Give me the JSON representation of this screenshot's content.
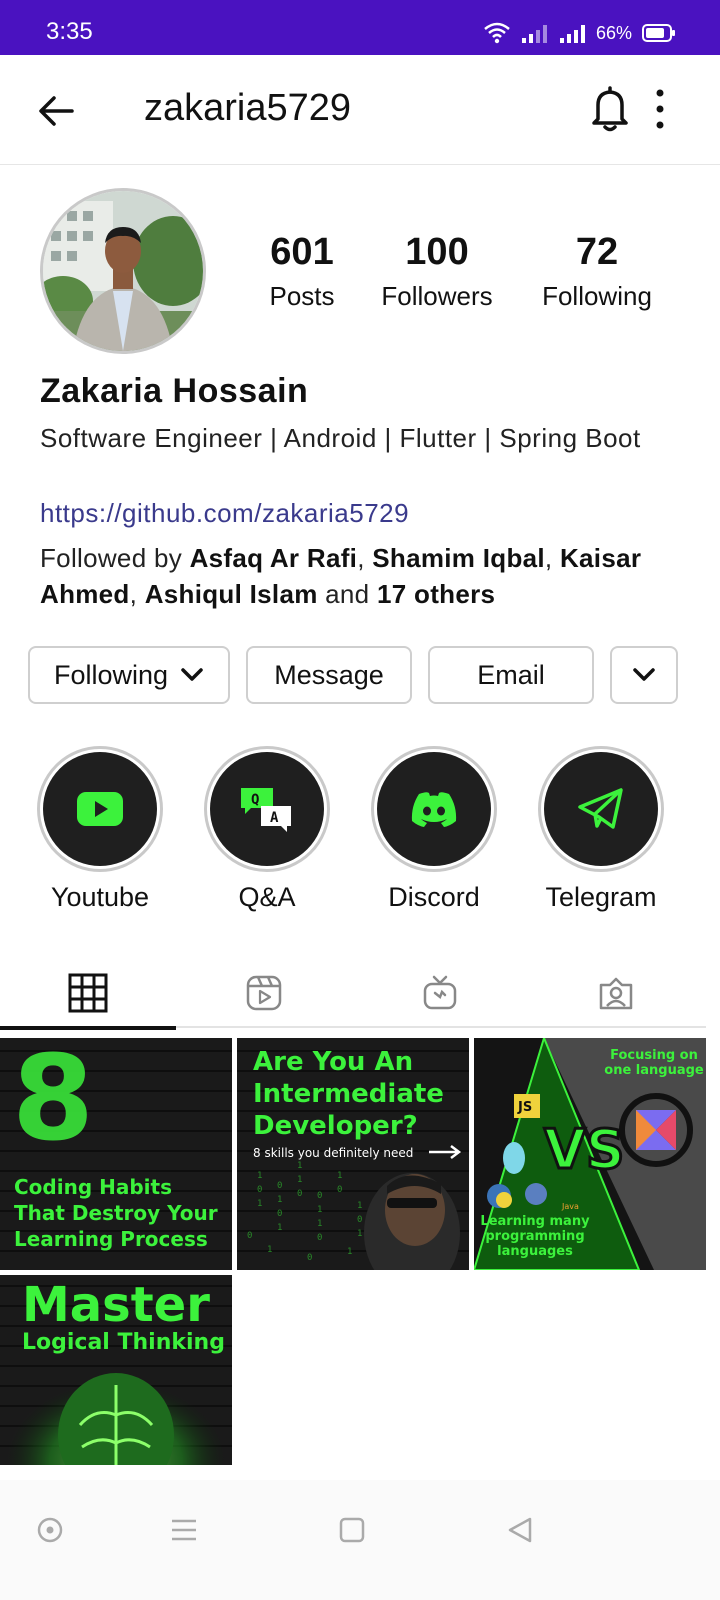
{
  "status": {
    "time": "3:35",
    "battery": "66%"
  },
  "header": {
    "username": "zakaria5729"
  },
  "stats": {
    "posts": {
      "value": "601",
      "label": "Posts"
    },
    "followers": {
      "value": "100",
      "label": "Followers"
    },
    "following": {
      "value": "72",
      "label": "Following"
    }
  },
  "profile": {
    "name": "Zakaria Hossain",
    "bio": "Software Engineer | Android | Flutter | Spring Boot",
    "link": "https://github.com/zakaria5729",
    "followed_by_prefix": "Followed by ",
    "followed_by_names": [
      "Asfaq Ar Rafi",
      "Shamim Iqbal",
      "Kaisar Ahmed",
      "Ashiqul Islam"
    ],
    "followed_by_and": " and ",
    "followed_by_others": "17 others"
  },
  "actions": {
    "following": "Following",
    "message": "Message",
    "email": "Email"
  },
  "highlights": [
    {
      "label": "Youtube",
      "icon": "youtube-icon"
    },
    {
      "label": "Q&A",
      "icon": "qa-icon"
    },
    {
      "label": "Discord",
      "icon": "discord-icon"
    },
    {
      "label": "Telegram",
      "icon": "telegram-icon"
    }
  ],
  "tabs": [
    "grid-icon",
    "reels-icon",
    "igtv-icon",
    "tagged-icon"
  ],
  "posts": [
    {
      "big": "8",
      "line1": "Coding Habits",
      "line2": "That Destroy Your",
      "line3": "Learning Process"
    },
    {
      "line1": "Are You An",
      "line2": "Intermediate",
      "line3": "Developer?",
      "sub": "8 skills you definitely need"
    },
    {
      "top": "Focusing on one language",
      "vs": "VS",
      "js": "JS",
      "java": "Java",
      "bottom": "Learning many programming languages"
    },
    {
      "line1": "Master",
      "line2": "Logical Thinking"
    }
  ],
  "colors": {
    "status_bar": "#4a12c0",
    "accent_green": "#3cf23c",
    "link": "#3a3a8c"
  }
}
